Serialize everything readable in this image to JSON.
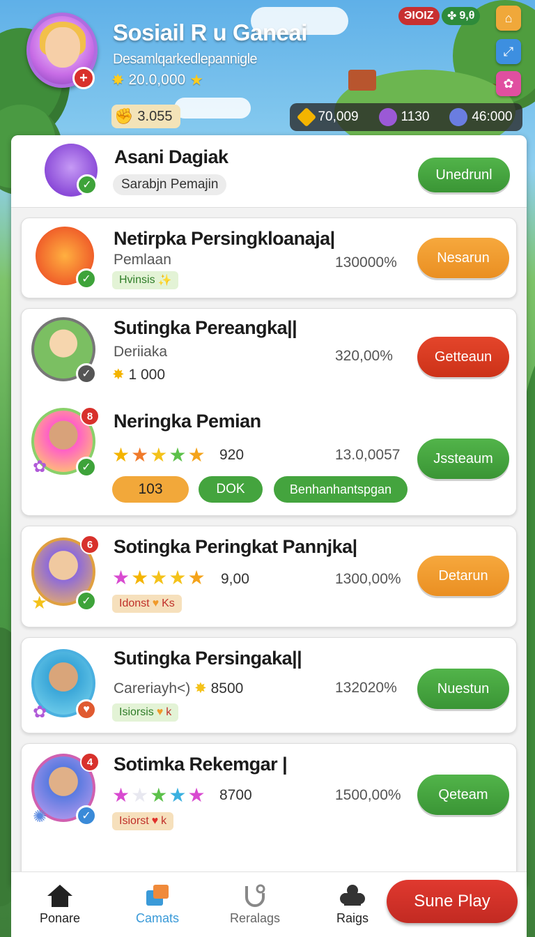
{
  "header": {
    "title": "Sosiail R u Ganeai",
    "subtitle": "Desamlqarkedlepannigle",
    "coins": "20.0,000",
    "gold_chip": "3.055",
    "top_pill_left": "ЭIOIZ",
    "top_pill_right": "9,θ",
    "resources": [
      {
        "value": "70,009",
        "icon": "gold-gem-icon",
        "color": "#f4b400"
      },
      {
        "value": "1130",
        "icon": "purple-orb-icon",
        "color": "#9b59d6"
      },
      {
        "value": "46:000",
        "icon": "blue-gem-icon",
        "color": "#6a7de0"
      }
    ]
  },
  "top_card": {
    "name": "Asani Dagiak",
    "chip": "Sarabjn Pemajin",
    "button": "Unedrunl"
  },
  "players": [
    {
      "name": "Netirpka Persingkloanaja|",
      "sub": "Pemlaan",
      "pct": "130000%",
      "tag": "Hvinsis",
      "button": "Nesarun",
      "btn_color": "orange"
    },
    {
      "name": "Sutingka Pereangka||",
      "sub": "Deriiaka",
      "coins": "1 000",
      "pct": "320,00%",
      "button": "Getteaun",
      "btn_color": "red"
    },
    {
      "name": "Neringka Pemian",
      "badge": "8",
      "score": "920",
      "pct": "13.0,0057",
      "pill_orange": "103",
      "pill_green": "DOK",
      "pill_green_wide": "Benhanhantspgan",
      "button": "Jssteaum",
      "btn_color": "green"
    },
    {
      "name": "Sotingka Peringkat Pannjka|",
      "badge": "6",
      "score": "9,00",
      "pct": "1300,00%",
      "tag": "Idonst",
      "tag_suffix": "Ks",
      "button": "Detarun",
      "btn_color": "orange"
    },
    {
      "name": "Sutingka Persingaka||",
      "sub": "Careriayh<)",
      "score": "8500",
      "pct": "132020%",
      "tag": "Isiorsis",
      "tag_suffix": "k",
      "button": "Nuestun",
      "btn_color": "green"
    },
    {
      "name": "Sotimka Rekemgar |",
      "badge": "4",
      "score": "8700",
      "pct": "1500,00%",
      "tag": "Isiorst",
      "tag_suffix": "k",
      "button": "Qeteam",
      "btn_color": "green"
    }
  ],
  "nav": {
    "items": [
      {
        "label": "Ponare",
        "icon": "home-icon"
      },
      {
        "label": "Camats",
        "icon": "cards-icon"
      },
      {
        "label": "Reralags",
        "icon": "magnet-icon"
      },
      {
        "label": "Raigs",
        "icon": "puzzle-icon"
      }
    ],
    "play": "Sune Play"
  }
}
